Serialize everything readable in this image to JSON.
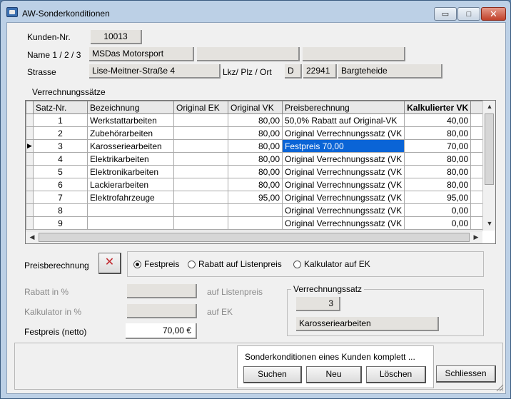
{
  "window": {
    "title": "AW-Sonderkonditionen",
    "close_symbol": "✕",
    "minimize_symbol": "▭",
    "maximize_symbol": "□"
  },
  "customer": {
    "number_label": "Kunden-Nr.",
    "number": "10013",
    "name_label": "Name 1 / 2 / 3",
    "name1": "MSDas Motorsport",
    "name2": "",
    "name3": "",
    "street_label": "Strasse",
    "street": "Lise-Meitner-Straße 4",
    "country_zip_city_label": "Lkz/ Plz / Ort",
    "country": "D",
    "zip": "22941",
    "city": "Bargteheide"
  },
  "rates": {
    "section_label": "Verrechnungssätze",
    "columns": [
      "Satz-Nr.",
      "Bezeichnung",
      "Original EK",
      "Original VK",
      "Preisberechnung",
      "Kalkulierter VK"
    ],
    "current_row_marker": "▶",
    "rows": [
      {
        "nr": "1",
        "name": "Werkstattarbeiten",
        "ek": "",
        "vk": "80,00",
        "calc": "50,0% Rabatt auf Original-VK",
        "kvk": "40,00"
      },
      {
        "nr": "2",
        "name": "Zubehörarbeiten",
        "ek": "",
        "vk": "80,00",
        "calc": "Original Verrechnungssatz (VK",
        "kvk": "80,00"
      },
      {
        "nr": "3",
        "name": "Karosseriearbeiten",
        "ek": "",
        "vk": "80,00",
        "calc": "Festpreis 70,00",
        "kvk": "70,00"
      },
      {
        "nr": "4",
        "name": "Elektrikarbeiten",
        "ek": "",
        "vk": "80,00",
        "calc": "Original Verrechnungssatz (VK",
        "kvk": "80,00"
      },
      {
        "nr": "5",
        "name": "Elektronikarbeiten",
        "ek": "",
        "vk": "80,00",
        "calc": "Original Verrechnungssatz (VK",
        "kvk": "80,00"
      },
      {
        "nr": "6",
        "name": "Lackierarbeiten",
        "ek": "",
        "vk": "80,00",
        "calc": "Original Verrechnungssatz (VK",
        "kvk": "80,00"
      },
      {
        "nr": "7",
        "name": "Elektrofahrzeuge",
        "ek": "",
        "vk": "95,00",
        "calc": "Original Verrechnungssatz (VK",
        "kvk": "95,00"
      },
      {
        "nr": "8",
        "name": "",
        "ek": "",
        "vk": "",
        "calc": "Original Verrechnungssatz (VK",
        "kvk": "0,00"
      },
      {
        "nr": "9",
        "name": "",
        "ek": "",
        "vk": "",
        "calc": "Original Verrechnungssatz (VK",
        "kvk": "0,00"
      }
    ],
    "selected_row_index": 2
  },
  "pricing": {
    "label": "Preisberechnung",
    "clear_icon": "✕",
    "options": [
      "Festpreis",
      "Rabatt auf Listenpreis",
      "Kalkulator auf EK"
    ],
    "selected_option": "Festpreis",
    "discount_label": "Rabatt in %",
    "discount_suffix": "auf Listenpreis",
    "discount_value": "",
    "calculator_label": "Kalkulator in %",
    "calculator_suffix": "auf EK",
    "calculator_value": "",
    "fixed_price_label": "Festpreis (netto)",
    "fixed_price_value": "70,00 €"
  },
  "rate_box": {
    "title": "Verrechnungssatz",
    "number": "3",
    "name": "Karosseriearbeiten"
  },
  "actions": {
    "panel_title": "Sonderkonditionen eines Kunden komplett ...",
    "search": "Suchen",
    "new": "Neu",
    "delete": "Löschen",
    "close": "Schliessen"
  }
}
